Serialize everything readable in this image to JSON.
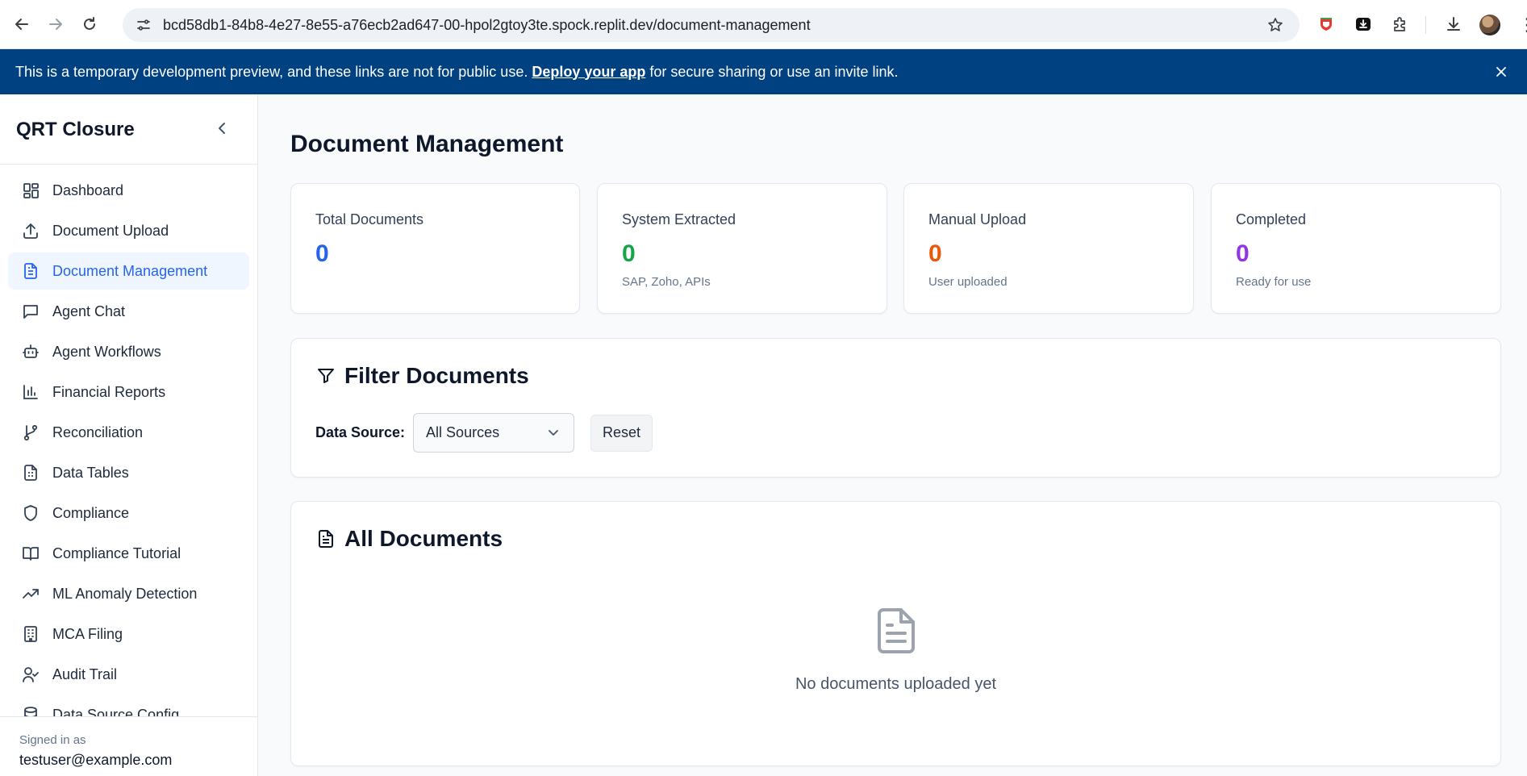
{
  "browser": {
    "url": "bcd58db1-84b8-4e27-8e55-a76ecb2ad647-00-hpol2gtoy3te.spock.replit.dev/document-management",
    "nav_icons": [
      "back-arrow-icon",
      "forward-arrow-icon",
      "reload-icon"
    ],
    "extension_icons": [
      "shield-extension-icon",
      "download-box-extension-icon",
      "puzzle-extensions-icon",
      "download-icon",
      "profile-avatar",
      "menu-kebab-icon"
    ]
  },
  "banner": {
    "text_before": "This is a temporary development preview, and these links are not for public use.",
    "link": "Deploy your app",
    "text_after": "for secure sharing or use an invite link."
  },
  "sidebar": {
    "brand": "QRT Closure",
    "items": [
      {
        "label": "Dashboard",
        "icon": "dashboard-icon"
      },
      {
        "label": "Document Upload",
        "icon": "upload-icon"
      },
      {
        "label": "Document Management",
        "icon": "file-text-icon",
        "active": true
      },
      {
        "label": "Agent Chat",
        "icon": "chat-icon"
      },
      {
        "label": "Agent Workflows",
        "icon": "bot-icon"
      },
      {
        "label": "Financial Reports",
        "icon": "bar-chart-icon"
      },
      {
        "label": "Reconciliation",
        "icon": "git-branch-icon"
      },
      {
        "label": "Data Tables",
        "icon": "spreadsheet-icon"
      },
      {
        "label": "Compliance",
        "icon": "shield-icon"
      },
      {
        "label": "Compliance Tutorial",
        "icon": "book-icon"
      },
      {
        "label": "ML Anomaly Detection",
        "icon": "trending-up-icon"
      },
      {
        "label": "MCA Filing",
        "icon": "building-icon"
      },
      {
        "label": "Audit Trail",
        "icon": "user-check-icon"
      },
      {
        "label": "Data Source Config",
        "icon": "database-icon"
      }
    ],
    "signed_in_label": "Signed in as",
    "user_email": "testuser@example.com"
  },
  "main": {
    "title": "Document Management",
    "stats": [
      {
        "label": "Total Documents",
        "value": "0",
        "sub": "",
        "color": "#2563eb"
      },
      {
        "label": "System Extracted",
        "value": "0",
        "sub": "SAP, Zoho, APIs",
        "color": "#16a34a"
      },
      {
        "label": "Manual Upload",
        "value": "0",
        "sub": "User uploaded",
        "color": "#ea580c"
      },
      {
        "label": "Completed",
        "value": "0",
        "sub": "Ready for use",
        "color": "#9333ea"
      }
    ],
    "filter": {
      "title": "Filter Documents",
      "data_source_label": "Data Source:",
      "selected_source": "All Sources",
      "reset_label": "Reset"
    },
    "documents": {
      "title": "All Documents",
      "empty_text": "No documents uploaded yet"
    }
  }
}
